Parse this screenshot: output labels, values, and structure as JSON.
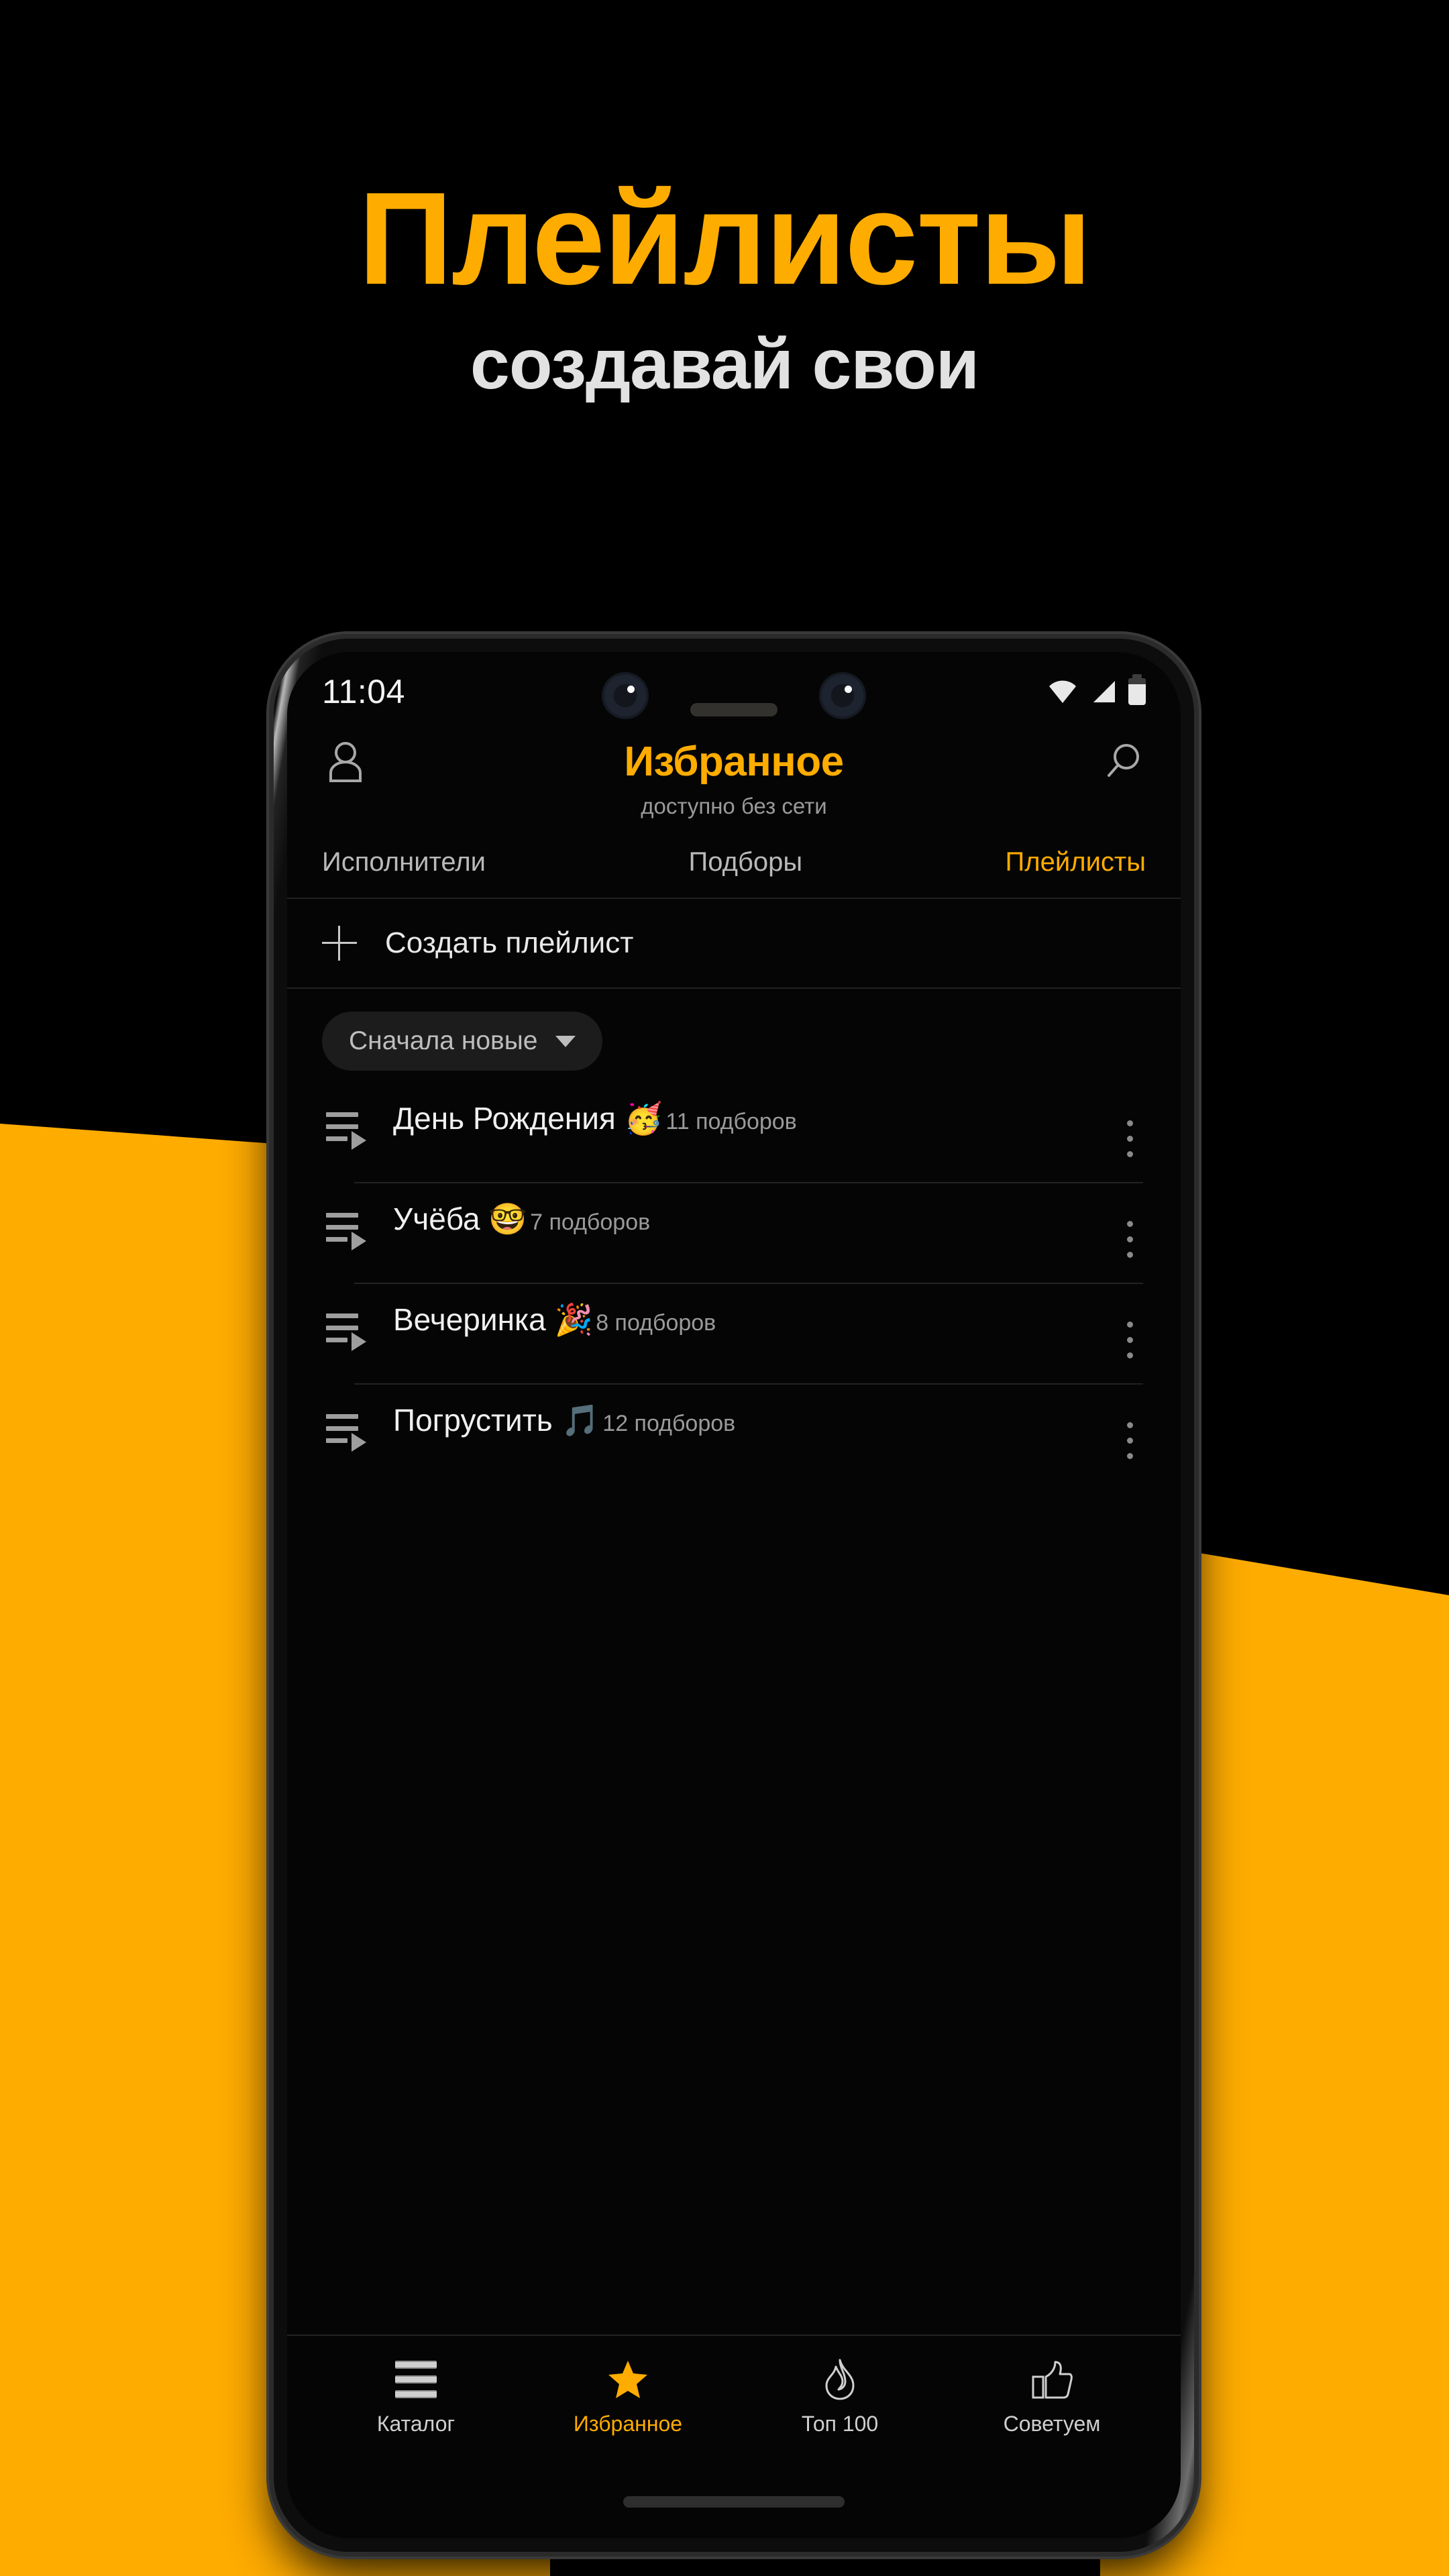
{
  "hero": {
    "title": "Плейлисты",
    "subtitle": "создавай свои",
    "title_color": "#FFAC00",
    "subtitle_color": "#E2E2E2"
  },
  "background": {
    "base_color": "#000000",
    "accent_color": "#FFAC00"
  },
  "status_bar": {
    "time": "11:04",
    "icons": [
      "wifi-icon",
      "cellular-signal-icon",
      "battery-icon"
    ]
  },
  "app_header": {
    "profile_icon": "person-icon",
    "title": "Избранное",
    "subtitle": "доступно без сети",
    "search_icon": "search-icon",
    "title_color": "#FFAC00"
  },
  "tabs": [
    {
      "label": "Исполнители",
      "active": false
    },
    {
      "label": "Подборы",
      "active": false
    },
    {
      "label": "Плейлисты",
      "active": true
    }
  ],
  "create_row": {
    "icon": "plus-icon",
    "label": "Создать плейлист"
  },
  "sort": {
    "label": "Сначала новые",
    "caret_icon": "chevron-down-icon"
  },
  "playlists": [
    {
      "title": "День Рождения 🥳",
      "count": "11 подборов",
      "icon": "playlist-icon",
      "menu_icon": "more-vertical-icon"
    },
    {
      "title": "Учёба 🤓",
      "count": "7 подборов",
      "icon": "playlist-icon",
      "menu_icon": "more-vertical-icon"
    },
    {
      "title": "Вечеринка 🎉",
      "count": "8 подборов",
      "icon": "playlist-icon",
      "menu_icon": "more-vertical-icon"
    },
    {
      "title": "Погрустить 🎵",
      "count": "12 подборов",
      "icon": "playlist-icon",
      "menu_icon": "more-vertical-icon"
    }
  ],
  "bottom_nav": [
    {
      "label": "Каталог",
      "icon": "list-icon",
      "active": false
    },
    {
      "label": "Избранное",
      "icon": "star-icon",
      "active": true
    },
    {
      "label": "Топ 100",
      "icon": "flame-icon",
      "active": false
    },
    {
      "label": "Советуем",
      "icon": "thumbs-up-icon",
      "active": false
    }
  ]
}
